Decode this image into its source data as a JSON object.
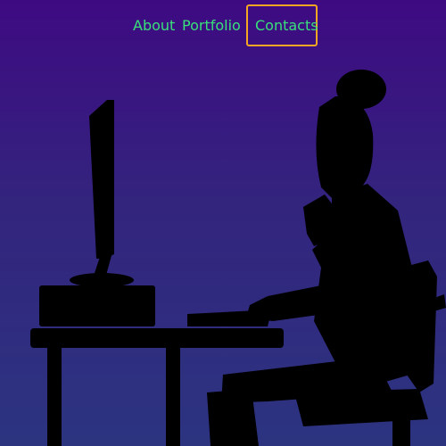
{
  "nav": {
    "items": [
      {
        "label": "About"
      },
      {
        "label": "Portfolio"
      },
      {
        "label": "Contacts"
      }
    ],
    "active": "Contacts"
  },
  "colors": {
    "background_top": "#3e0a82",
    "background_bottom": "#2c3480",
    "link": "#39e07a",
    "active_outline": "#f5a623",
    "silhouette": "#000000"
  },
  "illustration": {
    "name": "person-at-computer-silhouette"
  }
}
